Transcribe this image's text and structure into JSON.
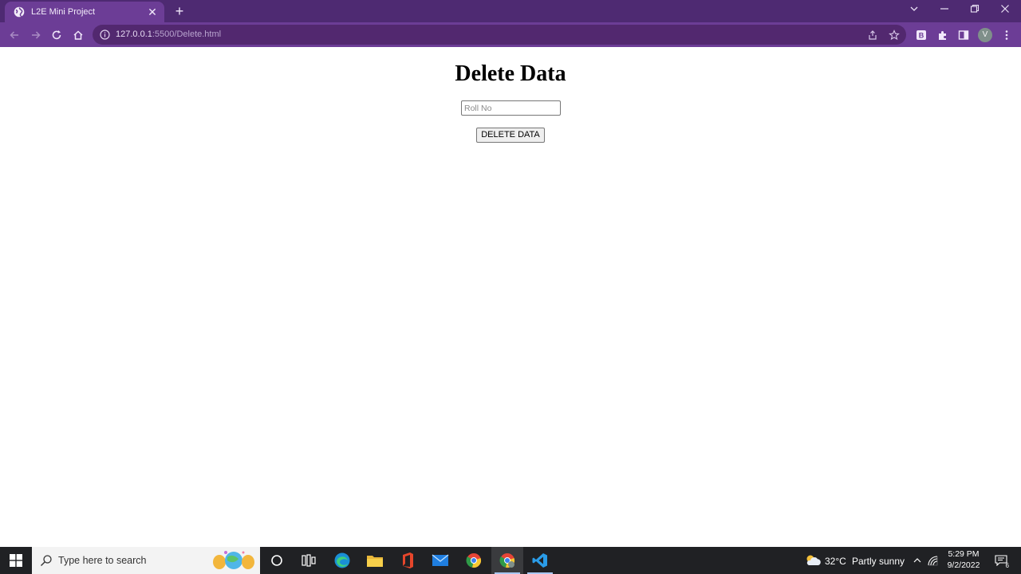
{
  "browser": {
    "tab_title": "L2E Mini Project",
    "url_host": "127.0.0.1",
    "url_rest": ":5500/Delete.html",
    "profile_initial": "V",
    "theme_color": "#6c3d96"
  },
  "page": {
    "title": "Delete Data",
    "roll_input_placeholder": "Roll No",
    "delete_button_label": "DELETE DATA"
  },
  "taskbar": {
    "search_placeholder": "Type here to search",
    "weather_temp": "32°C",
    "weather_desc": "Partly sunny",
    "time": "5:29 PM",
    "date": "9/2/2022",
    "notification_count": "6",
    "apps": [
      "cortana-icon",
      "task-view-icon",
      "edge-icon",
      "file-explorer-icon",
      "office-icon",
      "mail-icon",
      "chrome-icon",
      "chrome-profile-icon",
      "vscode-icon"
    ]
  }
}
